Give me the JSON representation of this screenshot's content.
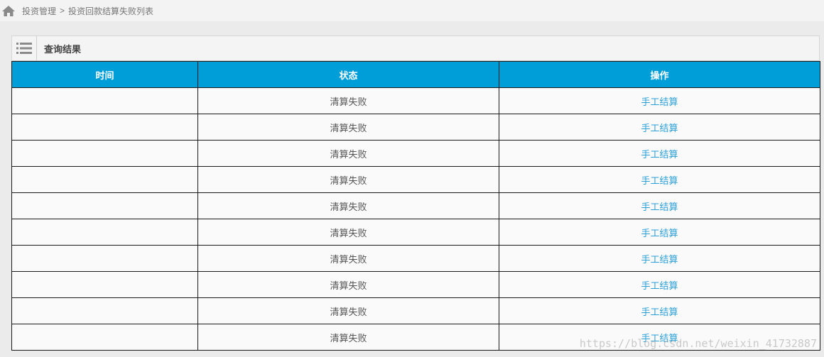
{
  "breadcrumb": {
    "home_icon": "home-icon",
    "parent": "投资管理",
    "separator": ">",
    "current": "投资回款结算失败列表"
  },
  "panel": {
    "icon": "list-icon",
    "title": "查询结果"
  },
  "table": {
    "header_color": "#009ed8",
    "link_color": "#2a9fd6",
    "columns": [
      "时间",
      "状态",
      "操作"
    ],
    "rows": [
      {
        "time": "",
        "status": "清算失败",
        "action": "手工结算"
      },
      {
        "time": "",
        "status": "清算失败",
        "action": "手工结算"
      },
      {
        "time": "",
        "status": "清算失败",
        "action": "手工结算"
      },
      {
        "time": "",
        "status": "清算失败",
        "action": "手工结算"
      },
      {
        "time": "",
        "status": "清算失败",
        "action": "手工结算"
      },
      {
        "time": "",
        "status": "清算失败",
        "action": "手工结算"
      },
      {
        "time": "",
        "status": "清算失败",
        "action": "手工结算"
      },
      {
        "time": "",
        "status": "清算失败",
        "action": "手工结算"
      },
      {
        "time": "",
        "status": "清算失败",
        "action": "手工结算"
      },
      {
        "time": "",
        "status": "清算失败",
        "action": "手工结算"
      }
    ]
  },
  "watermark": "https://blog.csdn.net/weixin_41732887"
}
